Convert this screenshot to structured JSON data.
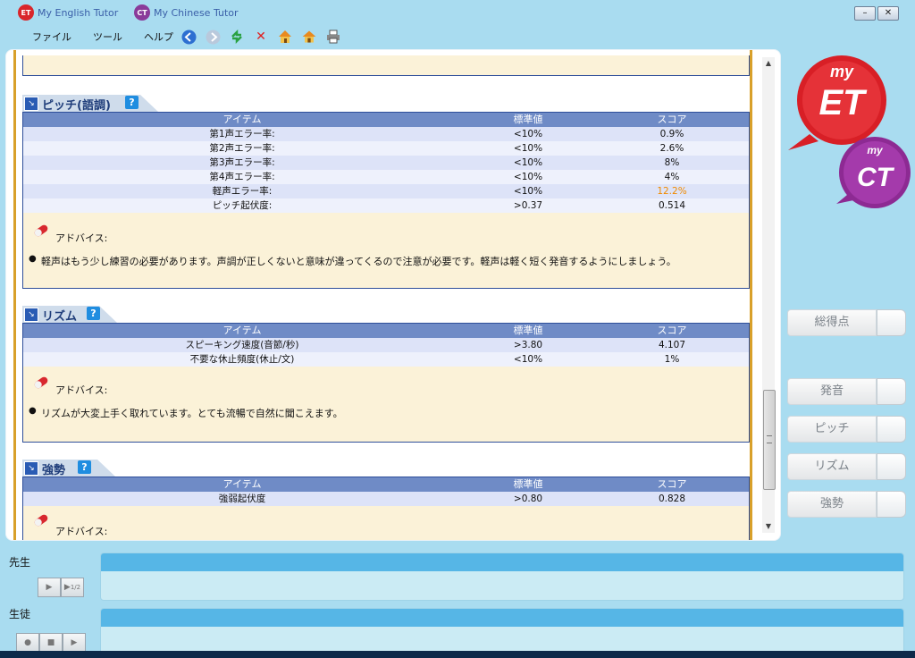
{
  "header": {
    "tabs": [
      {
        "label": "My English Tutor",
        "logo": "ET"
      },
      {
        "label": "My Chinese Tutor",
        "logo": "CT"
      }
    ],
    "window_buttons": [
      "minimize",
      "close"
    ]
  },
  "menu": [
    "ファイル",
    "ツール",
    "ヘルプ"
  ],
  "toolbar_icons": [
    "back-icon",
    "forward-icon",
    "refresh-icon",
    "stop-icon",
    "home-icon",
    "home2-icon",
    "print-icon"
  ],
  "sections": {
    "pitch": {
      "title": "ピッチ(語調)",
      "headers": {
        "item": "アイテム",
        "std": "標準値",
        "score": "スコア"
      },
      "rows": [
        {
          "item": "第1声エラー率:",
          "std": "<10%",
          "score": "0.9%"
        },
        {
          "item": "第2声エラー率:",
          "std": "<10%",
          "score": "2.6%"
        },
        {
          "item": "第3声エラー率:",
          "std": "<10%",
          "score": "8%"
        },
        {
          "item": "第4声エラー率:",
          "std": "<10%",
          "score": "4%"
        },
        {
          "item": "軽声エラー率:",
          "std": "<10%",
          "score": "12.2%"
        },
        {
          "item": "ピッチ起伏度:",
          "std": ">0.37",
          "score": "0.514"
        }
      ],
      "advice_label": "アドバイス:",
      "advice": "軽声はもう少し練習の必要があります。声調が正しくないと意味が違ってくるので注意が必要です。軽声は軽く短く発音するようにしましょう。"
    },
    "rhythm": {
      "title": "リズム",
      "headers": {
        "item": "アイテム",
        "std": "標準値",
        "score": "スコア"
      },
      "rows": [
        {
          "item": "スピーキング速度(音節/秒)",
          "std": ">3.80",
          "score": "4.107"
        },
        {
          "item": "不要な休止頻度(休止/文)",
          "std": "<10%",
          "score": "1%"
        }
      ],
      "advice_label": "アドバイス:",
      "advice": "リズムが大変上手く取れています。とても流暢で自然に聞こえます。"
    },
    "stress": {
      "title": "強勢",
      "headers": {
        "item": "アイテム",
        "std": "標準値",
        "score": "スコア"
      },
      "rows": [
        {
          "item": "強弱起伏度",
          "std": ">0.80",
          "score": "0.828"
        }
      ],
      "advice_label": "アドバイス:"
    }
  },
  "brand": {
    "primary": "my ET",
    "secondary": "my CT"
  },
  "side_buttons": [
    "総得点",
    "発音",
    "ピッチ",
    "リズム",
    "強勢"
  ],
  "bottom": {
    "teacher": "先生",
    "student": "生徒",
    "half_speed": "1/2"
  },
  "colors": {
    "accent": "#2f4f9a",
    "warning": "#f08a00",
    "panel_bg": "#fbf2d8",
    "window_bg": "#a9dcf0"
  }
}
